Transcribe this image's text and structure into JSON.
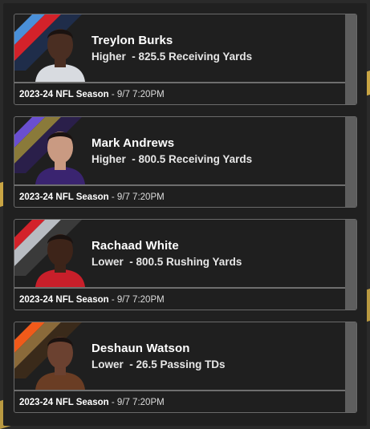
{
  "colors": {
    "background": "#202020",
    "card_border": "#6a6a6a",
    "scroll_strip": "#5e5e5e",
    "accent_gold": "#c9a544"
  },
  "cards": [
    {
      "player": "Treylon Burks",
      "direction": "Higher",
      "separator": " - ",
      "line": "825.5 Receiving Yards",
      "season": "2023-24 NFL Season",
      "time": " - 9/7 7:20PM",
      "stripe_colors": [
        "#4a90d9",
        "#d3222a",
        "#1f2d4a"
      ],
      "jersey_color": "#d8dbe0",
      "skin": "#4a2e22"
    },
    {
      "player": "Mark Andrews",
      "direction": "Higher",
      "separator": " - ",
      "line": "800.5 Receiving Yards",
      "season": "2023-24 NFL Season",
      "time": " - 9/7 7:20PM",
      "stripe_colors": [
        "#6a4fd0",
        "#8a7a3a",
        "#2a1f4a"
      ],
      "jersey_color": "#3a2470",
      "skin": "#c99a82"
    },
    {
      "player": "Rachaad White",
      "direction": "Lower",
      "separator": " - ",
      "line": "800.5 Rushing Yards",
      "season": "2023-24 NFL Season",
      "time": " - 9/7 7:20PM",
      "stripe_colors": [
        "#d3222a",
        "#b8bcc2",
        "#3a3a3a"
      ],
      "jersey_color": "#c81f2a",
      "skin": "#3d2419"
    },
    {
      "player": "Deshaun Watson",
      "direction": "Lower",
      "separator": " - ",
      "line": "26.5 Passing TDs",
      "season": "2023-24 NFL Season",
      "time": " - 9/7 7:20PM",
      "stripe_colors": [
        "#f05a1a",
        "#8a6a3a",
        "#3a2a1a"
      ],
      "jersey_color": "#6a3d24",
      "skin": "#6b4130"
    }
  ]
}
